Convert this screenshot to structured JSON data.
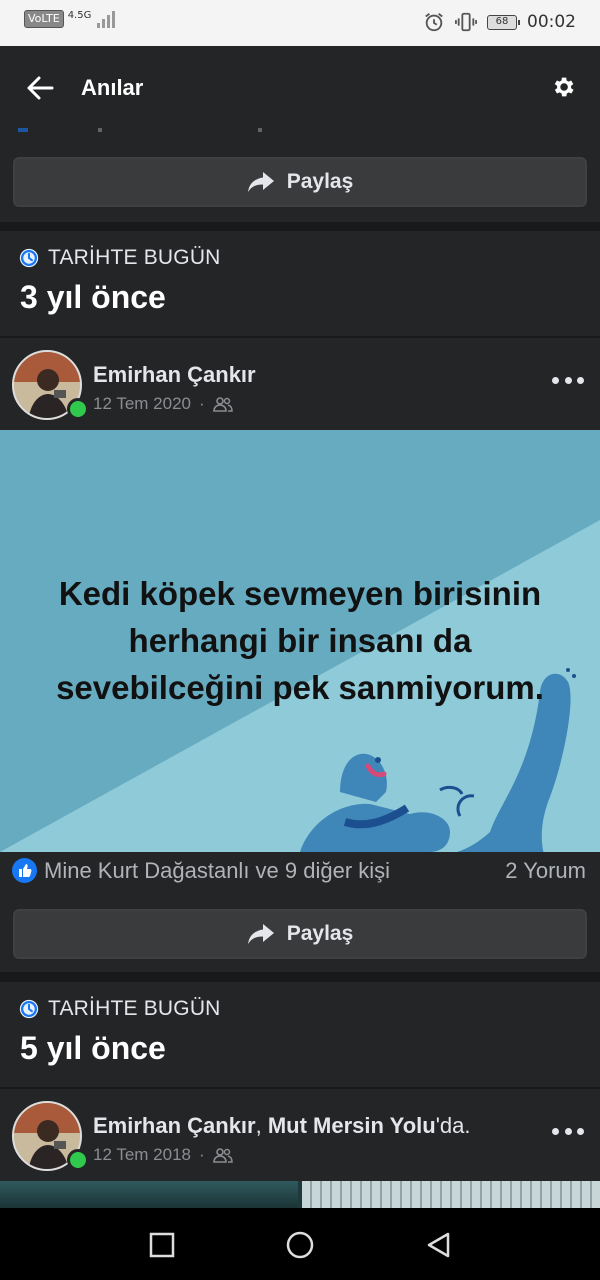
{
  "status_bar": {
    "volte": "VoLTE",
    "network": "4.5G",
    "battery": "68",
    "time": "00:02"
  },
  "header": {
    "title": "Anılar"
  },
  "top_card": {
    "share_label": "Paylaş"
  },
  "memories": [
    {
      "tag": "TARİHTE BUGÜN",
      "years_ago": "3 yıl önce",
      "author": "Emirhan Çankır",
      "date": "12 Tem 2020",
      "post_text": "Kedi köpek sevmeyen birisinin herhangi bir insanı da sevebilceğini pek sanmiyorum.",
      "post_text_lines": [
        "Kedi köpek sevmeyen birisinin",
        "herhangi bir insanı da",
        "sevebilceğini pek sanmiyorum."
      ],
      "likers": "Mine Kurt Dağastanlı ve 9 diğer kişi",
      "comments": "2 Yorum",
      "share_label": "Paylaş"
    },
    {
      "tag": "TARİHTE BUGÜN",
      "years_ago": "5 yıl önce",
      "author": "Emirhan Çankır",
      "location_sep": ", ",
      "location": "Mut Mersin Yolu",
      "location_suffix": "'da.",
      "date": "12 Tem 2018"
    }
  ],
  "icons": {
    "back": "arrow-left-icon",
    "settings": "gear-icon",
    "share": "share-arrow-icon",
    "memory": "clock-icon",
    "audience": "friends-icon",
    "more": "more-dots-icon",
    "like": "thumbs-up-icon"
  },
  "colors": {
    "background": "#18191a",
    "card": "#242526",
    "accent": "#1877f2",
    "online": "#31c94d",
    "post_bg": "#67abc0"
  }
}
